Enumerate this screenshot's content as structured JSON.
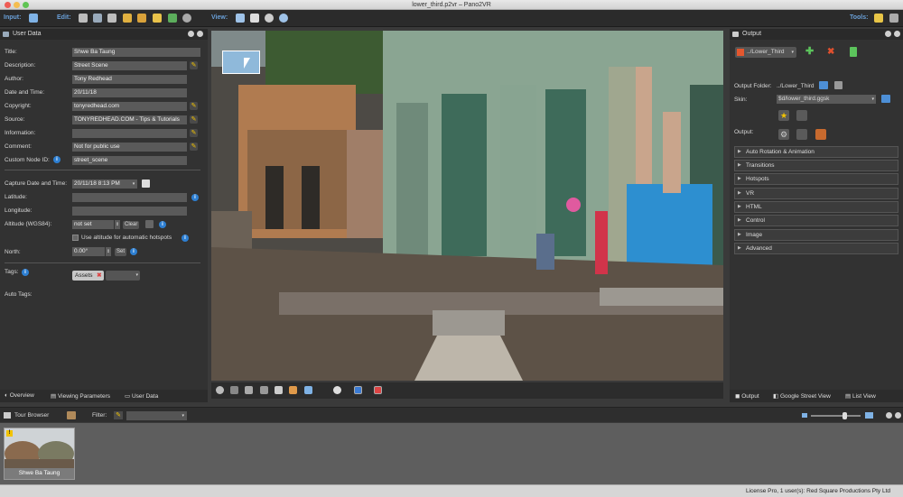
{
  "window": {
    "title": "lower_third.p2vr – Pano2VR"
  },
  "toolbar": {
    "input_label": "Input:",
    "edit_label": "Edit:",
    "view_label": "View:",
    "tools_label": "Tools:"
  },
  "user_data": {
    "header": "User Data",
    "title_label": "Title:",
    "title_value": "Shwe Ba Taung",
    "description_label": "Description:",
    "description_value": "Street Scene",
    "author_label": "Author:",
    "author_value": "Tony Redhead",
    "date_label": "Date and Time:",
    "date_value": "20/11/18",
    "copyright_label": "Copyright:",
    "copyright_value": "tonyredhead.com",
    "source_label": "Source:",
    "source_value": "TONYREDHEAD.COM - Tips & Tutorials",
    "information_label": "Information:",
    "information_value": "",
    "comment_label": "Comment:",
    "comment_value": "Not for public use",
    "custom_node_label": "Custom Node ID:",
    "custom_node_value": "street_scene",
    "capture_label": "Capture Date and Time:",
    "capture_value": "20/11/18 8:13 PM",
    "latitude_label": "Latitude:",
    "latitude_value": "",
    "longitude_label": "Longitude:",
    "longitude_value": "",
    "altitude_label": "Altitude (WGS84):",
    "altitude_value": "not set",
    "clear_label": "Clear",
    "use_altitude_label": "Use altitude for automatic hotspots",
    "north_label": "North:",
    "north_value": "0.00°",
    "set_label": "Set",
    "tags_label": "Tags:",
    "tag_assets": "Assets",
    "auto_tags_label": "Auto Tags:"
  },
  "left_tabs": {
    "overview": "Overview",
    "viewing": "Viewing Parameters",
    "user_data": "User Data"
  },
  "output": {
    "header": "Output",
    "format_value": "../Lower_Third",
    "folder_label": "Output Folder:",
    "folder_value": "../Lower_Third",
    "skin_label": "Skin:",
    "skin_value": "$d/lower_third.ggsk",
    "output_label": "Output:",
    "sections": [
      "Auto Rotation & Animation",
      "Transitions",
      "Hotspots",
      "VR",
      "HTML",
      "Control",
      "Image",
      "Advanced"
    ]
  },
  "right_tabs": {
    "output": "Output",
    "street_view": "Google Street View",
    "list_view": "List View"
  },
  "tour_browser": {
    "header": "Tour Browser",
    "filter_label": "Filter:",
    "node_label": "Shwe Ba Taung"
  },
  "status": {
    "text": "License Pro, 1 user(s): Red Square Productions Pty Ltd"
  }
}
